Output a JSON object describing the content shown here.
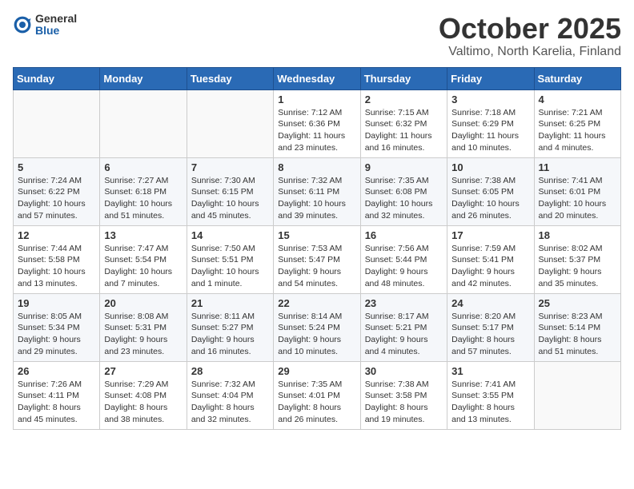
{
  "header": {
    "logo_general": "General",
    "logo_blue": "Blue",
    "month": "October 2025",
    "location": "Valtimo, North Karelia, Finland"
  },
  "weekdays": [
    "Sunday",
    "Monday",
    "Tuesday",
    "Wednesday",
    "Thursday",
    "Friday",
    "Saturday"
  ],
  "weeks": [
    [
      {
        "day": "",
        "content": ""
      },
      {
        "day": "",
        "content": ""
      },
      {
        "day": "",
        "content": ""
      },
      {
        "day": "1",
        "content": "Sunrise: 7:12 AM\nSunset: 6:36 PM\nDaylight: 11 hours\nand 23 minutes."
      },
      {
        "day": "2",
        "content": "Sunrise: 7:15 AM\nSunset: 6:32 PM\nDaylight: 11 hours\nand 16 minutes."
      },
      {
        "day": "3",
        "content": "Sunrise: 7:18 AM\nSunset: 6:29 PM\nDaylight: 11 hours\nand 10 minutes."
      },
      {
        "day": "4",
        "content": "Sunrise: 7:21 AM\nSunset: 6:25 PM\nDaylight: 11 hours\nand 4 minutes."
      }
    ],
    [
      {
        "day": "5",
        "content": "Sunrise: 7:24 AM\nSunset: 6:22 PM\nDaylight: 10 hours\nand 57 minutes."
      },
      {
        "day": "6",
        "content": "Sunrise: 7:27 AM\nSunset: 6:18 PM\nDaylight: 10 hours\nand 51 minutes."
      },
      {
        "day": "7",
        "content": "Sunrise: 7:30 AM\nSunset: 6:15 PM\nDaylight: 10 hours\nand 45 minutes."
      },
      {
        "day": "8",
        "content": "Sunrise: 7:32 AM\nSunset: 6:11 PM\nDaylight: 10 hours\nand 39 minutes."
      },
      {
        "day": "9",
        "content": "Sunrise: 7:35 AM\nSunset: 6:08 PM\nDaylight: 10 hours\nand 32 minutes."
      },
      {
        "day": "10",
        "content": "Sunrise: 7:38 AM\nSunset: 6:05 PM\nDaylight: 10 hours\nand 26 minutes."
      },
      {
        "day": "11",
        "content": "Sunrise: 7:41 AM\nSunset: 6:01 PM\nDaylight: 10 hours\nand 20 minutes."
      }
    ],
    [
      {
        "day": "12",
        "content": "Sunrise: 7:44 AM\nSunset: 5:58 PM\nDaylight: 10 hours\nand 13 minutes."
      },
      {
        "day": "13",
        "content": "Sunrise: 7:47 AM\nSunset: 5:54 PM\nDaylight: 10 hours\nand 7 minutes."
      },
      {
        "day": "14",
        "content": "Sunrise: 7:50 AM\nSunset: 5:51 PM\nDaylight: 10 hours\nand 1 minute."
      },
      {
        "day": "15",
        "content": "Sunrise: 7:53 AM\nSunset: 5:47 PM\nDaylight: 9 hours\nand 54 minutes."
      },
      {
        "day": "16",
        "content": "Sunrise: 7:56 AM\nSunset: 5:44 PM\nDaylight: 9 hours\nand 48 minutes."
      },
      {
        "day": "17",
        "content": "Sunrise: 7:59 AM\nSunset: 5:41 PM\nDaylight: 9 hours\nand 42 minutes."
      },
      {
        "day": "18",
        "content": "Sunrise: 8:02 AM\nSunset: 5:37 PM\nDaylight: 9 hours\nand 35 minutes."
      }
    ],
    [
      {
        "day": "19",
        "content": "Sunrise: 8:05 AM\nSunset: 5:34 PM\nDaylight: 9 hours\nand 29 minutes."
      },
      {
        "day": "20",
        "content": "Sunrise: 8:08 AM\nSunset: 5:31 PM\nDaylight: 9 hours\nand 23 minutes."
      },
      {
        "day": "21",
        "content": "Sunrise: 8:11 AM\nSunset: 5:27 PM\nDaylight: 9 hours\nand 16 minutes."
      },
      {
        "day": "22",
        "content": "Sunrise: 8:14 AM\nSunset: 5:24 PM\nDaylight: 9 hours\nand 10 minutes."
      },
      {
        "day": "23",
        "content": "Sunrise: 8:17 AM\nSunset: 5:21 PM\nDaylight: 9 hours\nand 4 minutes."
      },
      {
        "day": "24",
        "content": "Sunrise: 8:20 AM\nSunset: 5:17 PM\nDaylight: 8 hours\nand 57 minutes."
      },
      {
        "day": "25",
        "content": "Sunrise: 8:23 AM\nSunset: 5:14 PM\nDaylight: 8 hours\nand 51 minutes."
      }
    ],
    [
      {
        "day": "26",
        "content": "Sunrise: 7:26 AM\nSunset: 4:11 PM\nDaylight: 8 hours\nand 45 minutes."
      },
      {
        "day": "27",
        "content": "Sunrise: 7:29 AM\nSunset: 4:08 PM\nDaylight: 8 hours\nand 38 minutes."
      },
      {
        "day": "28",
        "content": "Sunrise: 7:32 AM\nSunset: 4:04 PM\nDaylight: 8 hours\nand 32 minutes."
      },
      {
        "day": "29",
        "content": "Sunrise: 7:35 AM\nSunset: 4:01 PM\nDaylight: 8 hours\nand 26 minutes."
      },
      {
        "day": "30",
        "content": "Sunrise: 7:38 AM\nSunset: 3:58 PM\nDaylight: 8 hours\nand 19 minutes."
      },
      {
        "day": "31",
        "content": "Sunrise: 7:41 AM\nSunset: 3:55 PM\nDaylight: 8 hours\nand 13 minutes."
      },
      {
        "day": "",
        "content": ""
      }
    ]
  ]
}
